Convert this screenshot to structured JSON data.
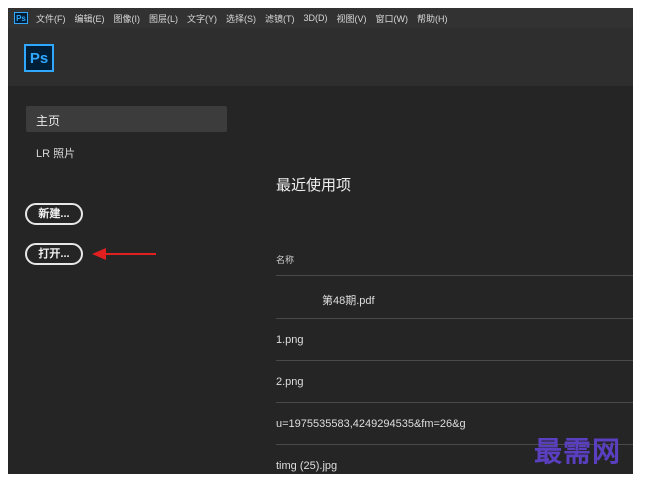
{
  "app": {
    "small_logo": "Ps",
    "logo": "Ps"
  },
  "menubar": {
    "items": [
      "文件(F)",
      "编辑(E)",
      "图像(I)",
      "图层(L)",
      "文字(Y)",
      "选择(S)",
      "滤镜(T)",
      "3D(D)",
      "视图(V)",
      "窗口(W)",
      "帮助(H)"
    ]
  },
  "sidebar": {
    "home_label": "主页",
    "lr_label": "LR 照片",
    "new_button": "新建...",
    "open_button": "打开..."
  },
  "recent": {
    "title": "最近使用项",
    "name_header": "名称",
    "files": [
      "第48期.pdf",
      "1.png",
      "2.png",
      "u=1975535583,4249294535&fm=26&g",
      "timg (25).jpg"
    ]
  },
  "watermark": "最需网",
  "colors": {
    "background": "#252525",
    "menubar": "#323232",
    "toolbar": "#2e2e2e",
    "ps_blue": "#31a8ff",
    "arrow_red": "#e02020",
    "watermark": "#5a3fc0"
  },
  "icons": {
    "arrow": "left-arrow-icon"
  }
}
